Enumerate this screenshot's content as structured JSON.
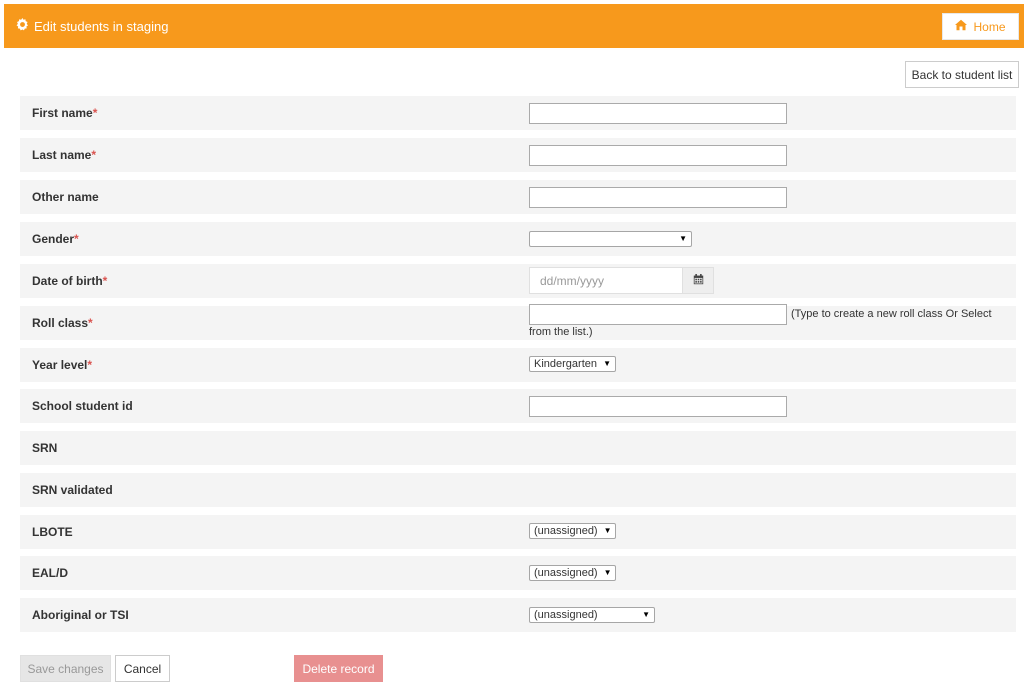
{
  "header": {
    "title": "Edit students in staging",
    "title_icon": "gear-icon",
    "home_label": "Home",
    "home_icon": "home-icon",
    "accent": "#f7991c"
  },
  "back_button": "Back to student list",
  "required_marker": "*",
  "fields": {
    "first_name": {
      "label": "First name",
      "value": ""
    },
    "last_name": {
      "label": "Last name",
      "value": ""
    },
    "other_name": {
      "label": "Other name",
      "value": ""
    },
    "gender": {
      "label": "Gender",
      "value": ""
    },
    "dob": {
      "label": "Date of birth",
      "placeholder": "dd/mm/yyyy",
      "icon": "calendar-icon"
    },
    "roll_class": {
      "label": "Roll class",
      "value": "",
      "hint_a": "(Type to create a new roll class Or Select",
      "hint_b": "from the list.)"
    },
    "year_level": {
      "label": "Year level",
      "value": "Kindergarten"
    },
    "school_student_id": {
      "label": "School student id",
      "value": ""
    },
    "srn": {
      "label": "SRN"
    },
    "srn_validated": {
      "label": "SRN validated"
    },
    "lbote": {
      "label": "LBOTE",
      "value": "(unassigned)"
    },
    "eald": {
      "label": "EAL/D",
      "value": "(unassigned)"
    },
    "aboriginal": {
      "label": "Aboriginal or TSI",
      "value": "(unassigned)"
    }
  },
  "actions": {
    "save": "Save changes",
    "cancel": "Cancel",
    "delete": "Delete record"
  }
}
